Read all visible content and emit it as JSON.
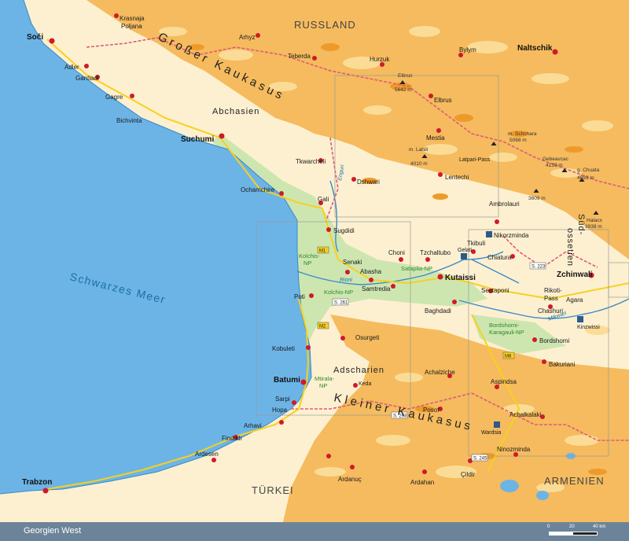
{
  "title": "Georgien West",
  "scale": {
    "zero": "0",
    "mid": "20",
    "end": "40 km"
  },
  "countries": {
    "russia": "RUSSLAND",
    "turkey": "TÜRKEI",
    "armenia": "ARMENIEN"
  },
  "sea": "Schwarzes Meer",
  "regions": {
    "abkhazia": "Abchasien",
    "adjara": "Adscharien",
    "greater_caucasus": "Großer Kaukasus",
    "lesser_caucasus": "Kleiner Kaukasus",
    "south_ossetia_1": "Süd-",
    "south_ossetia_2": "ossetien"
  },
  "cities": {
    "soci": "Soči",
    "krasnaja": "Krasnaja",
    "poljana": "Poljana",
    "adler": "Adler",
    "gantiadi": "Gantiadi",
    "gagre": "Gagre",
    "bichvinta": "Bichvinta",
    "suchumi": "Suchumi",
    "tkwarcheli": "Tkwarcheli",
    "ochamchire": "Ochamchire",
    "gali": "Gali",
    "sugdidi": "Sugdidi",
    "poti": "Poti",
    "kobuleti": "Kobuleti",
    "batumi": "Batumi",
    "sarpi": "Sarpi",
    "hopa": "Hopa",
    "arhavi": "Arhavi",
    "findikli": "Findıklı",
    "ardesen": "Ardesen",
    "trabzon": "Trabzon",
    "arhyz": "Arhyz",
    "teberda": "Teberda",
    "hurzuk": "Hurzuk",
    "elbrus": "Elbrus",
    "bylym": "Bylym",
    "naltschik": "Naltschik",
    "mestia": "Mestia",
    "dshwari": "Dshwari",
    "lentechi": "Lentechi",
    "ambrolauri": "Ambrolauri",
    "senaki": "Senaki",
    "choni": "Choni",
    "tzchaltubo": "Tzchaltubo",
    "abasha": "Abasha",
    "samtredia": "Samtredia",
    "kutaissi": "Kutaissi",
    "gelati": "Gelati",
    "tkibuli": "Tkibuli",
    "nikorzminda": "Nikorzminda",
    "chiatura": "Chiatura",
    "zchinwali": "Zchinwali",
    "sestaponi": "Sestaponi",
    "rikoti": "Rikoti-",
    "rikoti2": "Pass",
    "agara": "Agara",
    "chashuri": "Chashuri",
    "kinzwissi": "Kinzwissi",
    "baghdadi": "Baghdadi",
    "osurgeti": "Osurgeti",
    "bordshomi": "Bordshomi",
    "bakuriani": "Bakuriani",
    "achalziche": "Achalziche",
    "aspindsa": "Aspindsa",
    "achalkalaki": "Achalkalaki",
    "wardsia": "Wardsia",
    "ninozminda": "Ninozminda",
    "keda": "Keda",
    "posof": "Posof",
    "ardanuc": "Ardanuç",
    "ardahan": "Ardahan",
    "cildir": "Çildir",
    "latpari": "Latpari-Pass"
  },
  "parks": {
    "kolchis1a": "Kolchis-",
    "kolchis1b": "NP",
    "kolchis2": "Kolchis-NP",
    "sataplia": "Sataplia-NP",
    "borjomi1": "Bordshomi-",
    "borjomi2": "Karagauli-NP",
    "mtirala1": "Mtirala-",
    "mtirala2": "NP"
  },
  "peaks": {
    "elbrus_name": "Elbrus",
    "elbrus_h": "5642 m",
    "lahili_name": "m. Lahili",
    "lahili_h": "4010 m",
    "schchara_name": "m. Schchara",
    "schchara_h": "5068 m",
    "gebeavcac_name": "Gebeavcac",
    "gebeavcac_h": "4139 m",
    "chuata_name": "g. Chuata",
    "chuata_h": "4693 m",
    "p3609": "3609 m",
    "halacx_name": "Halacx",
    "halacx_h": "3938 m"
  },
  "rivers": {
    "rioni": "Rioni",
    "mtkwari": "Mtkwari",
    "enguri": "Enguri"
  },
  "roads": {
    "m1a": "M1",
    "m1b": "M1",
    "m2": "M2",
    "s261": "S. 261",
    "s223": "S. 223",
    "s293": "S. 293",
    "s245": "S. 245",
    "m8": "M8"
  },
  "colors": {
    "sea": "#6cb4e6",
    "land": "#fdf0d0",
    "mountain": "#f3b24a",
    "lowland": "#cde6b0",
    "city": "#d0192c",
    "footer": "#6c8499",
    "border": "#e05a7a"
  }
}
